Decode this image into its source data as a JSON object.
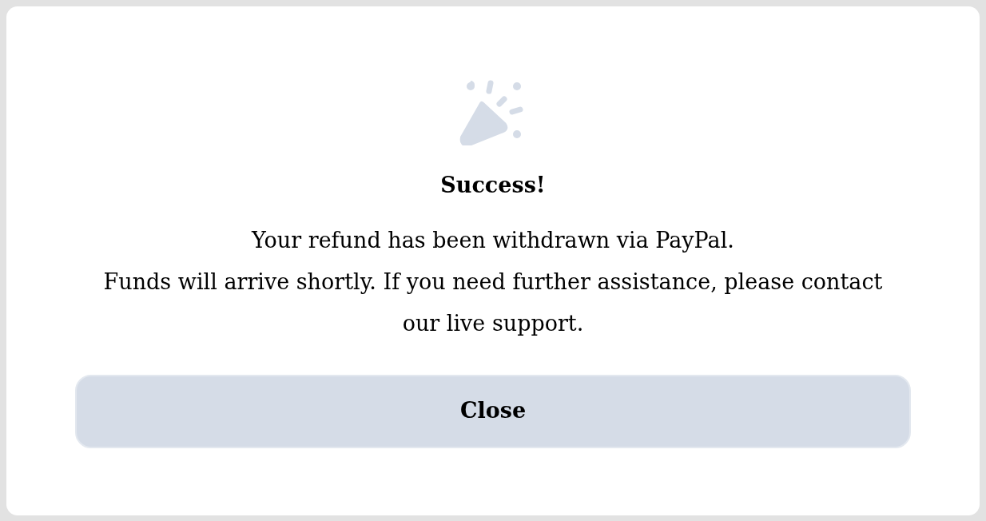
{
  "dialog": {
    "title": "Success!",
    "message_lines": [
      "Your refund has been withdrawn via PayPal.",
      "Funds will arrive shortly. If you need further assistance, please contact our live support."
    ],
    "button": "Close"
  }
}
